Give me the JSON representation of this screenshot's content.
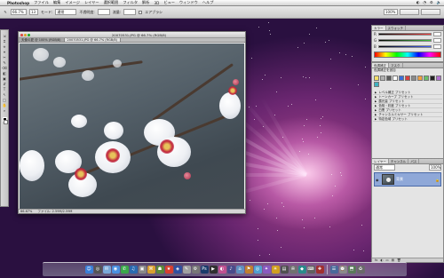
{
  "menubar": {
    "apple": "",
    "app_name": "Photoshop",
    "items": [
      "ファイル",
      "編集",
      "イメージ",
      "レイヤー",
      "選択範囲",
      "フィルタ",
      "解析",
      "3D",
      "ビュー",
      "ウィンドウ",
      "ヘルプ"
    ],
    "status_icons": [
      "◐",
      "◔",
      "⚙",
      "🔈"
    ]
  },
  "optionsbar": {
    "zoom": "66.7%",
    "brush_size": "13",
    "mode_label": "モード:",
    "mode_value": "通常",
    "opacity_label": "不透明度:",
    "flow_label": "流量:",
    "airbrush_label": "エアブラシ",
    "zoom_right": "100%"
  },
  "toolbox": {
    "tools": [
      "⇲",
      "⌗",
      "⟡",
      "⌖",
      "✂",
      "✎",
      "⌫",
      "◧",
      "▣",
      "⇵",
      "T",
      "↖",
      "□",
      "✋",
      "⌕"
    ]
  },
  "document": {
    "title": "20070531.JPG @ 66.7% (RGB/8)",
    "tabs": [
      "天使の夏 @ 100% (RGB/8)",
      "20070531.JPG @ 66.7% (RGB/8)"
    ],
    "active_tab": 1,
    "status_zoom": "66.67%",
    "status_info": "ファイル: 2.59M/2.59M"
  },
  "color_panel": {
    "tabs": [
      "カラー",
      "スウォッチ"
    ],
    "channels": [
      "R",
      "G",
      "B"
    ],
    "ramp_colors": [
      "#ff4040",
      "#40c040",
      "#4060ff"
    ]
  },
  "adjust_panel": {
    "tabs": [
      "色調補正",
      "マスク"
    ],
    "header": "色調補正を追加",
    "swatch_colors": [
      "#f5e06a",
      "#b0b0b0",
      "#5a5a5a",
      "#ffffff",
      "#3a6fd8",
      "#d84040",
      "#8a8a8a",
      "#f0a040",
      "#6ac06a",
      "#222222",
      "#b070d0",
      "#40b0c0"
    ],
    "presets": [
      "レベル補正 プリセット",
      "トーンカーブ プリセット",
      "露光量 プリセット",
      "色相・彩度 プリセット",
      "白黒 プリセット",
      "チャンネルミキサー プリセット",
      "特定色域 プリセット"
    ]
  },
  "layers_panel": {
    "tabs": [
      "レイヤー",
      "チャンネル",
      "パス"
    ],
    "blend_mode": "通常",
    "opacity": "100%",
    "layer_name": "背景",
    "bottom_icons": [
      "fx",
      "◐",
      "▭",
      "▤",
      "🗑"
    ]
  },
  "dock": {
    "icons": [
      {
        "glyph": "☺",
        "color": "#3a7fd8"
      },
      {
        "glyph": "◎",
        "color": "#555555"
      },
      {
        "glyph": "✉",
        "color": "#7aa8d8"
      },
      {
        "glyph": "◉",
        "color": "#4a90e0"
      },
      {
        "glyph": "✆",
        "color": "#3aa84a"
      },
      {
        "glyph": "♫",
        "color": "#2a6ab0"
      },
      {
        "glyph": "▣",
        "color": "#888888"
      },
      {
        "glyph": "⌘",
        "color": "#d8a030"
      },
      {
        "glyph": "☗",
        "color": "#5a8a3a"
      },
      {
        "glyph": "★",
        "color": "#d84030"
      },
      {
        "glyph": "◈",
        "color": "#3050a0"
      },
      {
        "glyph": "✎",
        "color": "#a0a0a0"
      },
      {
        "glyph": "⚙",
        "color": "#777777"
      },
      {
        "glyph": "Ps",
        "color": "#1a3a6a"
      },
      {
        "glyph": "▶",
        "color": "#303030"
      },
      {
        "glyph": "◐",
        "color": "#c05090"
      },
      {
        "glyph": "♪",
        "color": "#4a4a8a"
      },
      {
        "glyph": "⌂",
        "color": "#6090c0"
      },
      {
        "glyph": "⚑",
        "color": "#c08030"
      },
      {
        "glyph": "◎",
        "color": "#50a0d0"
      },
      {
        "glyph": "✦",
        "color": "#8a5ac0"
      },
      {
        "glyph": "☀",
        "color": "#d0a020"
      },
      {
        "glyph": "▤",
        "color": "#505050"
      },
      {
        "glyph": "✇",
        "color": "#707070"
      },
      {
        "glyph": "◆",
        "color": "#2a8a8a"
      },
      {
        "glyph": "⌨",
        "color": "#606060"
      },
      {
        "glyph": "✚",
        "color": "#a03030"
      },
      {
        "glyph": "☰",
        "color": "#4a6a9a"
      },
      {
        "glyph": "⌚",
        "color": "#8a8a8a"
      },
      {
        "glyph": "⬒",
        "color": "#5a7a5a"
      },
      {
        "glyph": "♻",
        "color": "#6a6a6a"
      }
    ]
  }
}
